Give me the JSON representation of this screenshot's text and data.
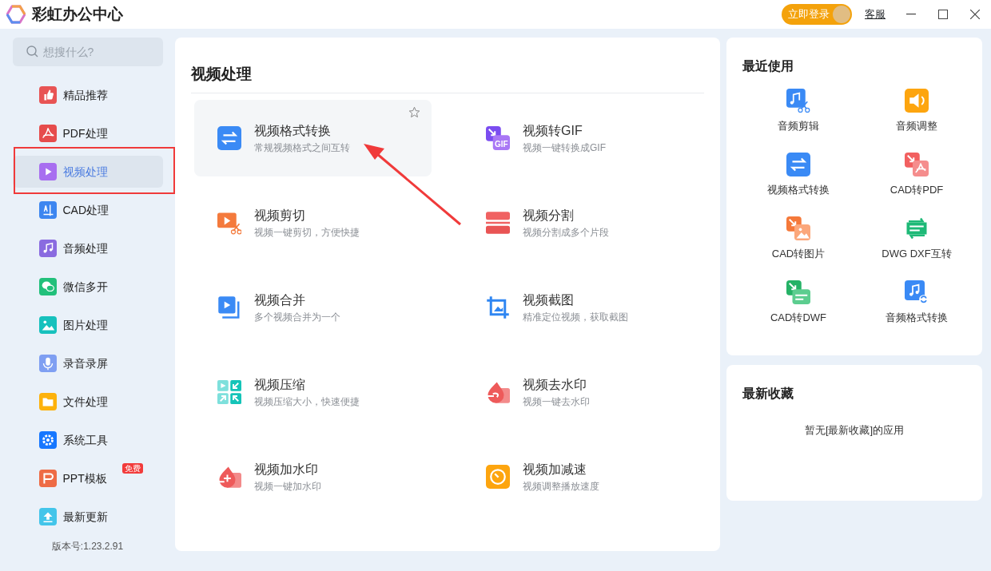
{
  "window": {
    "title": "彩虹办公中心",
    "login_button": "立即登录",
    "support_link": "客服"
  },
  "sidebar": {
    "search": {
      "placeholder": "想搜什么?"
    },
    "items": [
      {
        "label": "精品推荐",
        "kind": "thumb",
        "selected": false
      },
      {
        "label": "PDF处理",
        "kind": "pdf",
        "selected": false
      },
      {
        "label": "视频处理",
        "kind": "play",
        "selected": true
      },
      {
        "label": "CAD处理",
        "kind": "cad",
        "selected": false
      },
      {
        "label": "音频处理",
        "kind": "music",
        "selected": false
      },
      {
        "label": "微信多开",
        "kind": "wechat",
        "selected": false
      },
      {
        "label": "图片处理",
        "kind": "image",
        "selected": false
      },
      {
        "label": "录音录屏",
        "kind": "mic",
        "selected": false
      },
      {
        "label": "文件处理",
        "kind": "folder",
        "selected": false
      },
      {
        "label": "系统工具",
        "kind": "gear",
        "selected": false
      },
      {
        "label": "PPT模板",
        "kind": "ppt",
        "selected": false,
        "badge": "免费"
      },
      {
        "label": "最新更新",
        "kind": "upload",
        "selected": false
      }
    ],
    "version": "版本号:1.23.2.91"
  },
  "main": {
    "title": "视频处理",
    "tools": [
      {
        "name": "视频格式转换",
        "description": "常规视频格式之间互转",
        "kind": "convert",
        "selected": true
      },
      {
        "name": "视频转GIF",
        "description": "视频一键转换成GIF",
        "kind": "gif",
        "icon_text": "GIF",
        "selected": false
      },
      {
        "name": "视频剪切",
        "description": "视频一键剪切，方便快捷",
        "kind": "cut",
        "selected": false
      },
      {
        "name": "视频分割",
        "description": "视频分割成多个片段",
        "kind": "split",
        "selected": false
      },
      {
        "name": "视频合并",
        "description": "多个视频合并为一个",
        "kind": "merge",
        "selected": false
      },
      {
        "name": "视频截图",
        "description": "精准定位视频，获取截图",
        "kind": "crop",
        "selected": false
      },
      {
        "name": "视频压缩",
        "description": "视频压缩大小，快速便捷",
        "kind": "compress",
        "selected": false
      },
      {
        "name": "视频去水印",
        "description": "视频一键去水印",
        "kind": "unmark",
        "selected": false
      },
      {
        "name": "视频加水印",
        "description": "视频一键加水印",
        "kind": "addmark",
        "selected": false
      },
      {
        "name": "视频加减速",
        "description": "视频调整播放速度",
        "kind": "speed",
        "selected": false
      }
    ]
  },
  "recent": {
    "title": "最近使用",
    "items": [
      {
        "label": "音频剪辑",
        "kind": "audiocut"
      },
      {
        "label": "音频调整",
        "kind": "volume"
      },
      {
        "label": "视频格式转换",
        "kind": "convert"
      },
      {
        "label": "CAD转PDF",
        "kind": "cadpdf"
      },
      {
        "label": "CAD转图片",
        "kind": "cadimg"
      },
      {
        "label": "DWG DXF互转",
        "kind": "dwg"
      },
      {
        "label": "CAD转DWF",
        "kind": "caddwf"
      },
      {
        "label": "音频格式转换",
        "kind": "audioconv"
      }
    ]
  },
  "favorites": {
    "title": "最新收藏",
    "empty_text": "暂无[最新收藏]的应用"
  }
}
